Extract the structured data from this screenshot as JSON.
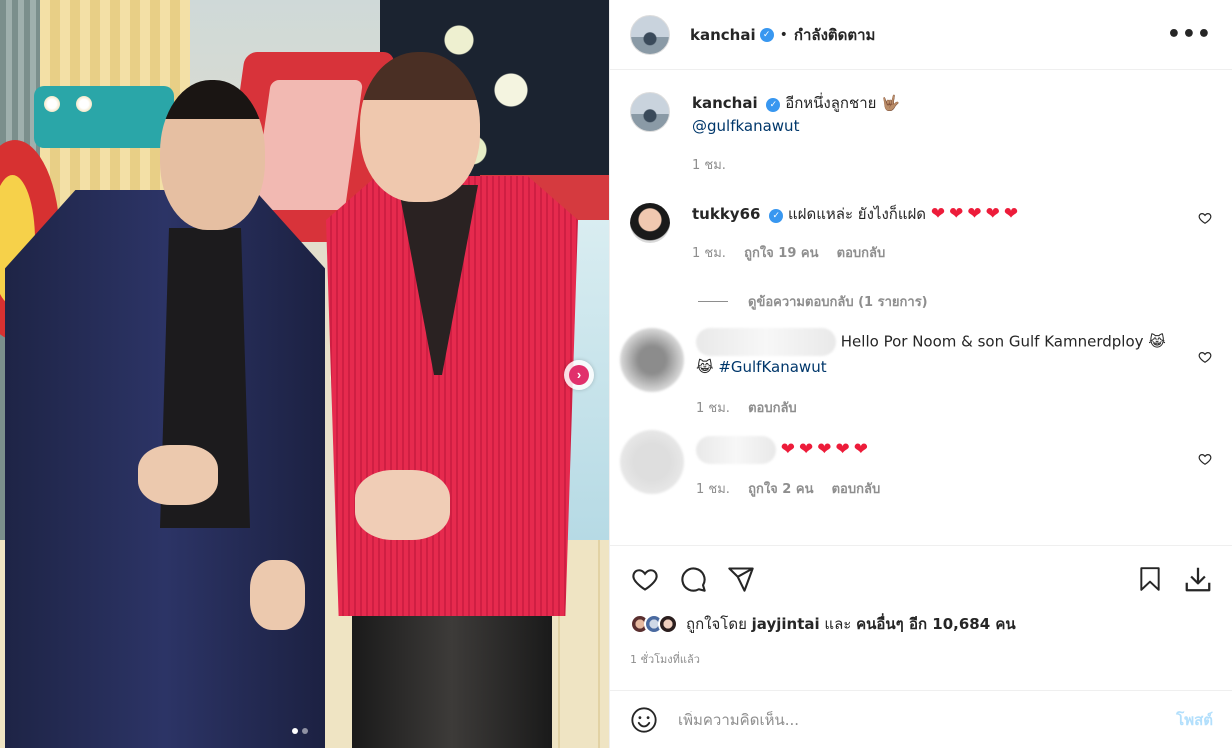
{
  "colors": {
    "accent": "#3897f0",
    "heart": "#ed1c3a",
    "post_disabled": "#b2dffc",
    "muted": "#8e8e8e"
  },
  "header": {
    "username": "kanchai",
    "separator": "•",
    "follow_status": "กำลังติดตาม",
    "more_label": "•••"
  },
  "caption": {
    "username": "kanchai",
    "text": "อีกหนึ่งลูกชาย",
    "emoji": "🤟🏽",
    "mention": "@gulfkanawut",
    "time": "1 ชม."
  },
  "comments": [
    {
      "username": "tukky66",
      "text": "แฝดแหล่ะ ยังไงก็แฝด",
      "hearts": "❤❤❤❤❤",
      "time": "1 ชม.",
      "likes": "ถูกใจ 19 คน",
      "reply": "ตอบกลับ",
      "view_replies": "ดูข้อความตอบกลับ (1 รายการ)"
    },
    {
      "username": "",
      "text": "Hello Por Noom & son Gulf Kamnerdploy",
      "emoji": "😹",
      "emoji2": "😹",
      "hashtag": "#GulfKanawut",
      "time": "1 ชม.",
      "reply": "ตอบกลับ"
    },
    {
      "username": "",
      "hearts": "❤❤❤❤❤",
      "time": "1 ชม.",
      "likes": "ถูกใจ 2 คน",
      "reply": "ตอบกลับ"
    }
  ],
  "actions": {
    "icons": [
      "heart-icon",
      "comment-icon",
      "share-icon",
      "bookmark-icon",
      "download-icon"
    ],
    "likes_prefix": "ถูกใจโดย",
    "likes_user": "jayjintai",
    "likes_and": "และ",
    "likes_others": "คนอื่นๆ อีก 10,684 คน",
    "time_ago": "1 ชั่วโมงที่แล้ว"
  },
  "add_comment": {
    "placeholder": "เพิ่มความคิดเห็น...",
    "post_label": "โพสต์"
  },
  "carousel": {
    "total_slides": 2,
    "active_slide": 1
  }
}
